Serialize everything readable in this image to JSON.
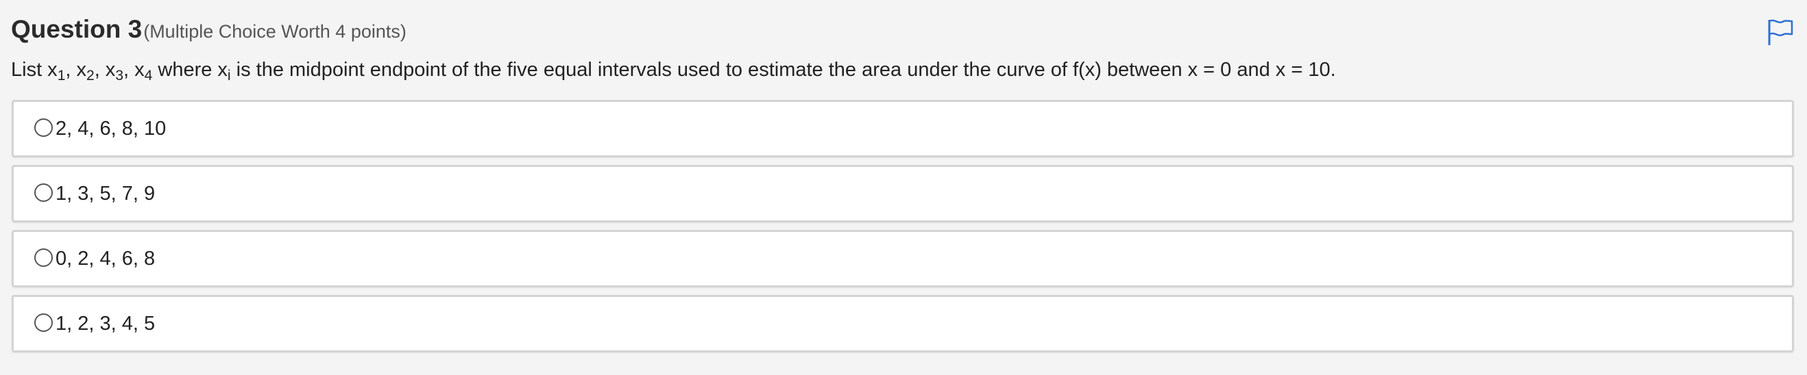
{
  "question": {
    "title": "Question 3",
    "worth": "(Multiple Choice Worth 4 points)",
    "flag_icon": "flag-icon",
    "flag_color": "#2f6fd1"
  },
  "prompt": {
    "lead": "List x",
    "sub1": "1",
    "sep1": ", x",
    "sub2": "2",
    "sep2": ", x",
    "sub3": "3",
    "sep3": ", x",
    "sub4": "4",
    "mid": " where x",
    "subi": "i",
    "tail": " is the midpoint endpoint of the five equal intervals used to estimate the area under the curve of f(x) between x = 0 and x = 10."
  },
  "options": [
    {
      "label": "2, 4, 6, 8, 10",
      "selected": false
    },
    {
      "label": "1, 3, 5, 7, 9",
      "selected": false
    },
    {
      "label": "0, 2, 4, 6, 8",
      "selected": false
    },
    {
      "label": "1, 2, 3, 4, 5",
      "selected": false
    }
  ]
}
